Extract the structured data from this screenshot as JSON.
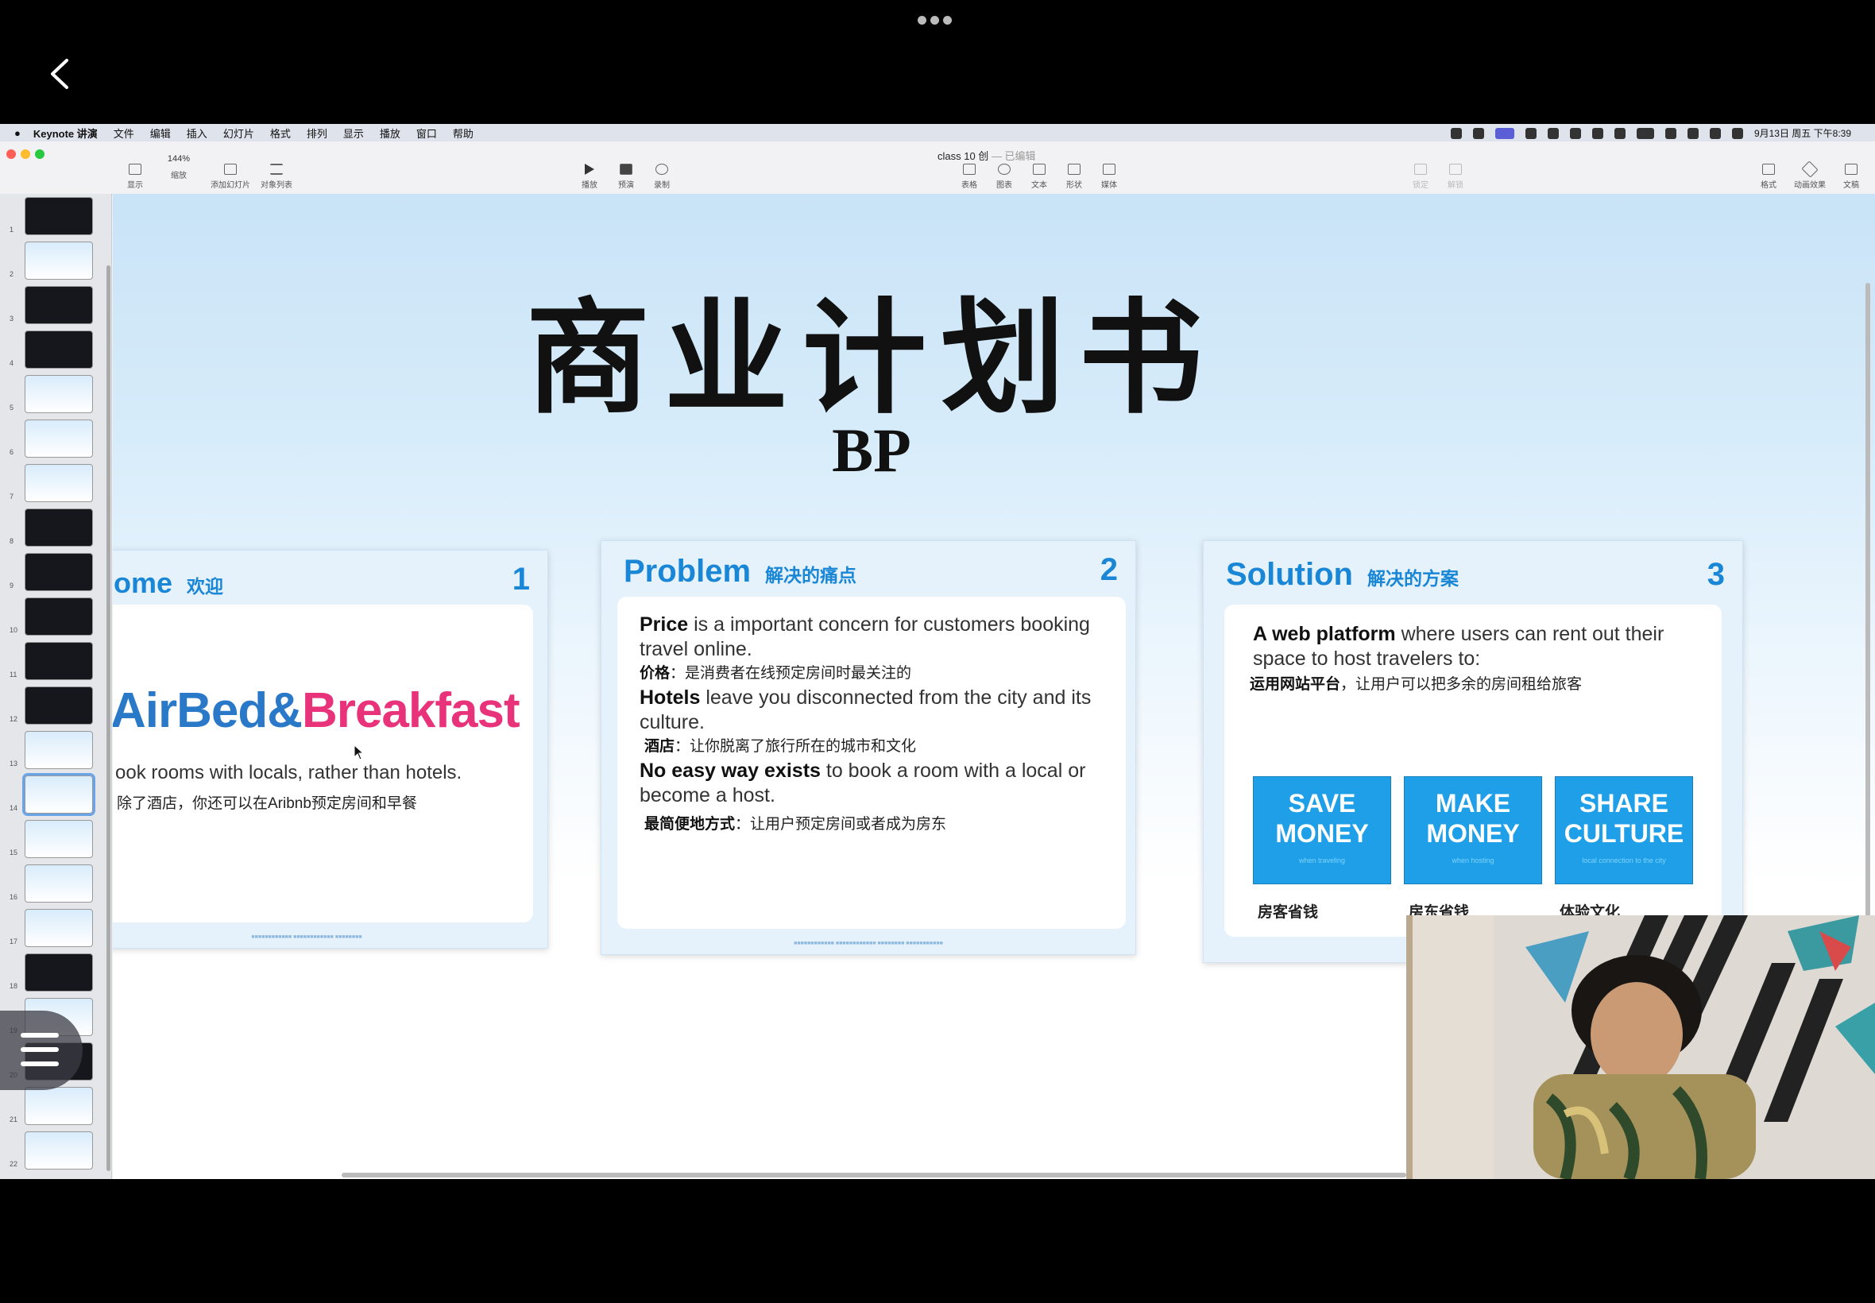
{
  "menubar": {
    "app_name": "Keynote 讲演",
    "items": [
      "文件",
      "编辑",
      "插入",
      "幻灯片",
      "格式",
      "排列",
      "显示",
      "播放",
      "窗口",
      "帮助"
    ],
    "datetime": "9月13日 周五 下午8:39"
  },
  "window": {
    "doc_title": "class 10 创",
    "doc_status": "— 已编辑"
  },
  "toolbar": {
    "left": [
      {
        "label": "显示",
        "icon": "sidebar-icon"
      },
      {
        "label": "缩放",
        "value": "144%",
        "icon": "zoom-icon"
      },
      {
        "label": "添加幻灯片",
        "icon": "add-slide-icon"
      },
      {
        "label": "对象列表",
        "icon": "list-icon"
      },
      {
        "label": "播放",
        "icon": "play-icon"
      },
      {
        "label": "预演",
        "icon": "rehearse-icon"
      },
      {
        "label": "录制",
        "icon": "record-icon"
      }
    ],
    "center": [
      {
        "label": "表格",
        "icon": "table-icon"
      },
      {
        "label": "图表",
        "icon": "chart-icon"
      },
      {
        "label": "文本",
        "icon": "text-icon"
      },
      {
        "label": "形状",
        "icon": "shape-icon"
      },
      {
        "label": "媒体",
        "icon": "media-icon"
      }
    ],
    "mid_right": [
      {
        "label": "锁定",
        "icon": "lock-icon"
      },
      {
        "label": "解锁",
        "icon": "unlock-icon"
      }
    ],
    "right": [
      {
        "label": "格式",
        "icon": "format-icon"
      },
      {
        "label": "动画效果",
        "icon": "animate-icon"
      },
      {
        "label": "文稿",
        "icon": "document-icon"
      }
    ]
  },
  "slide": {
    "title": "商业计划书",
    "subtitle": "BP",
    "cards": [
      {
        "heading": "ome",
        "heading_zh": "欢迎",
        "number": "1",
        "logo_part1": "AirBed&",
        "logo_part2": "Breakfast",
        "line_en": "ook rooms with locals, rather than hotels.",
        "line_zh": "除了酒店，你还可以在Aribnb预定房间和早餐"
      },
      {
        "heading": "Problem",
        "heading_zh": "解决的痛点",
        "number": "2",
        "p1_bold": "Price",
        "p1_rest": " is a important concern for customers booking travel online.",
        "p1_zh_bold": "价格",
        "p1_zh_rest": "：是消费者在线预定房间时最关注的",
        "p2_bold": "Hotels",
        "p2_rest": " leave you disconnected from the city and its culture.",
        "p2_zh_bold": "酒店",
        "p2_zh_rest": "：让你脱离了旅行所在的城市和文化",
        "p3_bold": "No easy way exists",
        "p3_rest": " to book a room with a local or become a host.",
        "p3_zh_bold": "最简便地方式",
        "p3_zh_rest": "：让用户预定房间或者成为房东"
      },
      {
        "heading": "Solution",
        "heading_zh": "解决的方案",
        "number": "3",
        "intro_bold": "A web platform",
        "intro_rest": " where users can rent out their space to host travelers to:",
        "intro_zh_bold": "运用网站平台",
        "intro_zh_rest": "，让用户可以把多余的房间租给旅客",
        "buttons": [
          {
            "line1": "SAVE",
            "line2": "MONEY",
            "caption": "when traveling",
            "label": "房客省钱"
          },
          {
            "line1": "MAKE",
            "line2": "MONEY",
            "caption": "when hosting",
            "label": "房东省钱"
          },
          {
            "line1": "SHARE",
            "line2": "CULTURE",
            "caption": "local connection to the city",
            "label": "体验文化"
          }
        ]
      }
    ]
  },
  "thumbnails": {
    "count": 22,
    "selected": 14,
    "numbers": [
      "1",
      "2",
      "3",
      "4",
      "5",
      "6",
      "7",
      "8",
      "9",
      "10",
      "11",
      "12",
      "13",
      "14",
      "15",
      "16",
      "17",
      "18",
      "19",
      "20",
      "21",
      "22"
    ]
  },
  "colors": {
    "accent": "#1a86d6",
    "button_blue": "#1e9fe8",
    "logo_blue": "#2a78c8",
    "logo_pink": "#e8327a"
  }
}
